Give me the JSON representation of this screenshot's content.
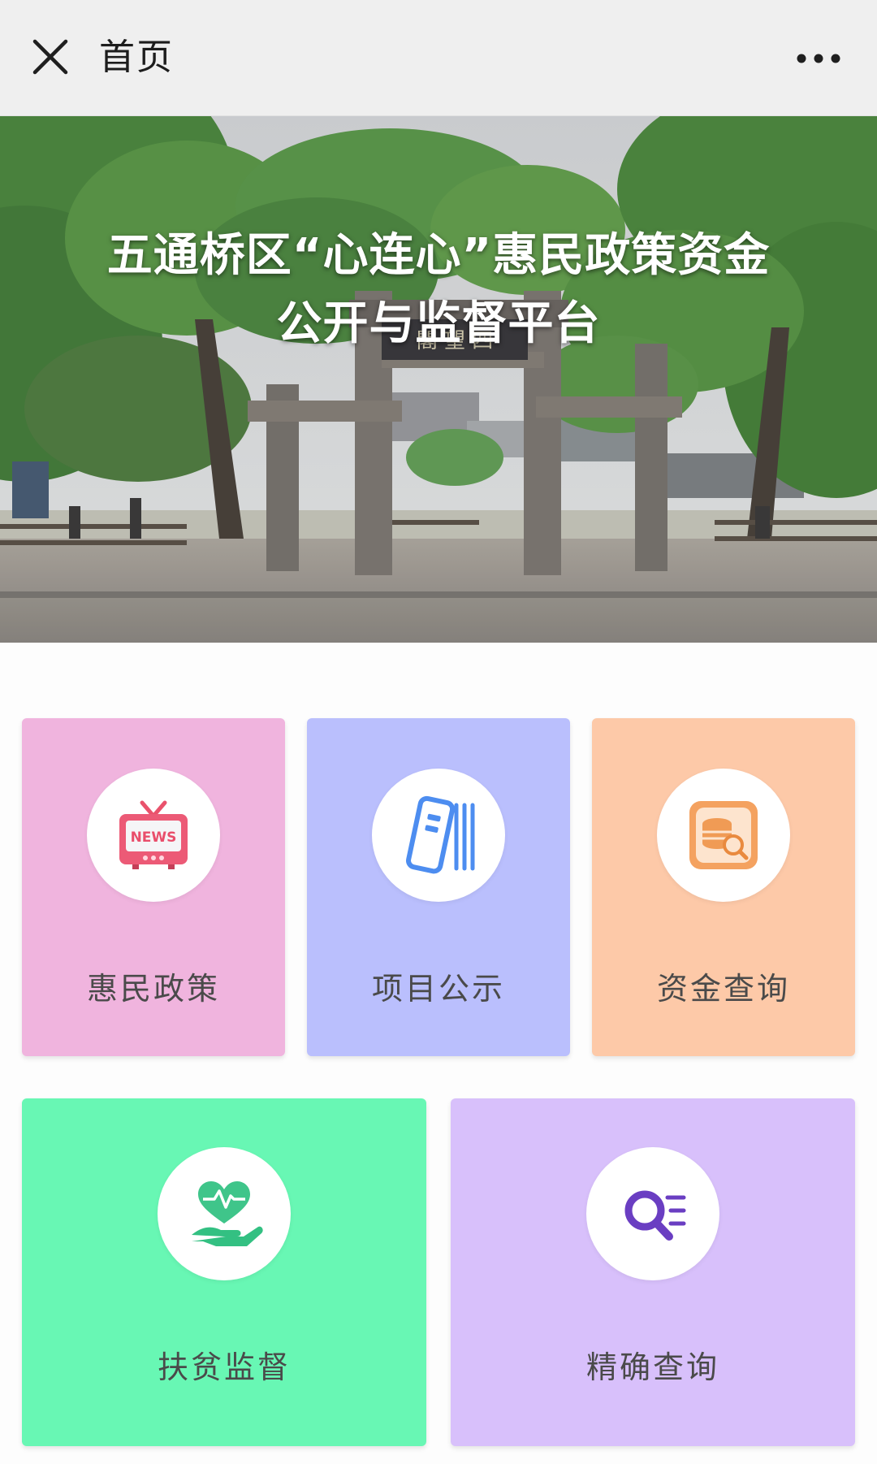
{
  "topbar": {
    "title": "首页",
    "close_icon": "close-icon",
    "more_icon": "more-dots-icon"
  },
  "hero": {
    "title_line1": "五通桥区“心连心”惠民政策资金",
    "title_line2": "公开与监督平台",
    "gate_plaque": "閣 望 四"
  },
  "tiles": [
    {
      "label": "惠民政策",
      "icon": "news-tv-icon",
      "color": "#f0b4de"
    },
    {
      "label": "项目公示",
      "icon": "document-list-icon",
      "color": "#babffd"
    },
    {
      "label": "资金查询",
      "icon": "database-search-icon",
      "color": "#fdc9a8"
    },
    {
      "label": "扶贫监督",
      "icon": "heart-hand-icon",
      "color": "#68f7b4"
    },
    {
      "label": "精确查询",
      "icon": "search-list-icon",
      "color": "#d8c0fb"
    }
  ]
}
